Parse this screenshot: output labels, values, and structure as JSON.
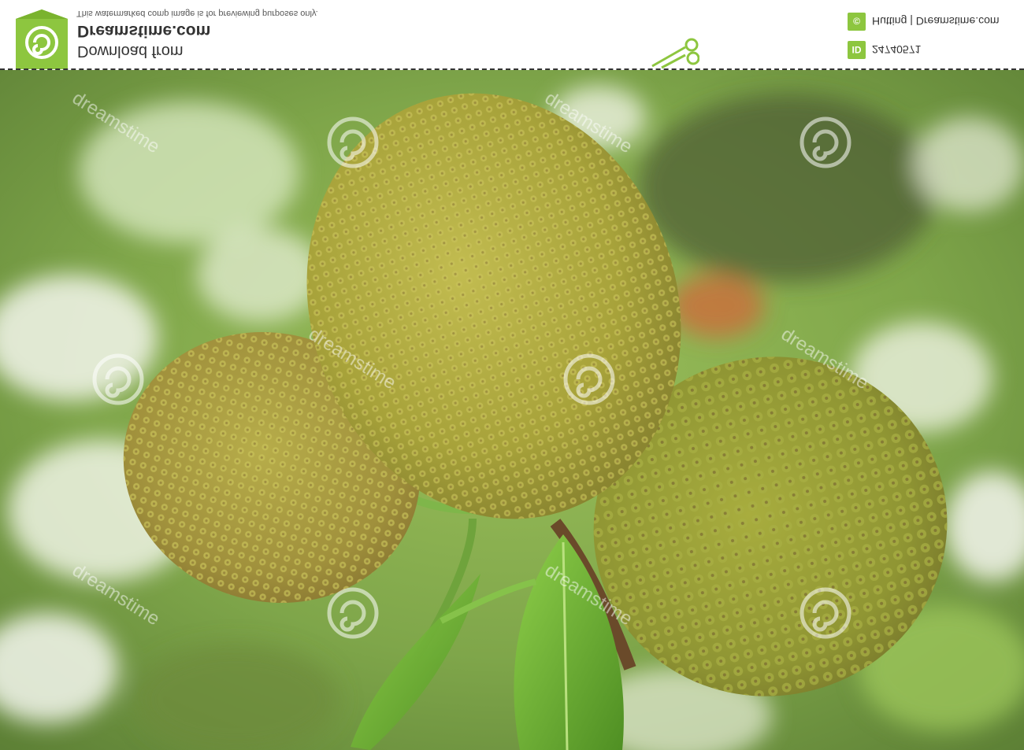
{
  "header": {
    "brand_name": "Dreamstime.com",
    "download_label": "Download from",
    "watermark_notice": "This watermarked comp image is for previewing purposes only.",
    "author_badge_icon": "copyright-icon",
    "author_credit": "Hutting | Dreamstime.com",
    "id_badge": "ID",
    "image_id": "24740571",
    "accent_color": "#8dc63f"
  },
  "photo": {
    "watermark_word": "dreamstime",
    "watermark_icon": "spiral-icon"
  }
}
